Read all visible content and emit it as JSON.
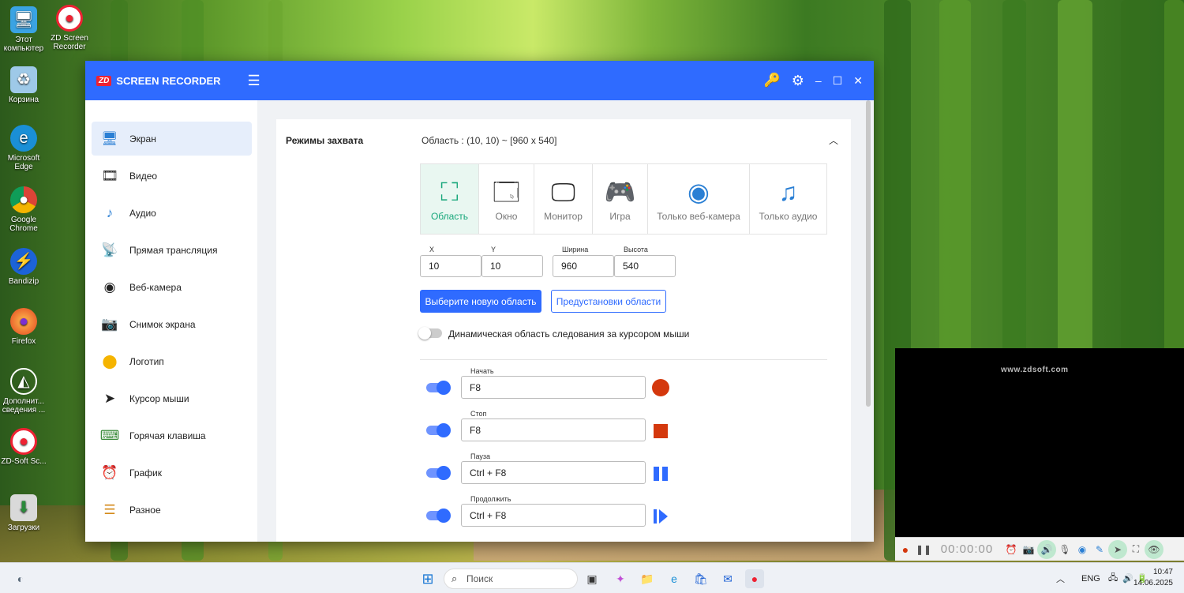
{
  "desktop": {
    "icons": [
      {
        "label": "Этот компьютер"
      },
      {
        "label": "ZD Screen Recorder"
      },
      {
        "label": "Корзина"
      },
      {
        "label": "Microsoft Edge"
      },
      {
        "label": "Google Chrome"
      },
      {
        "label": "Bandizip"
      },
      {
        "label": "Firefox"
      },
      {
        "label": "Дополнит... сведения ..."
      },
      {
        "label": "ZD-Soft Sc..."
      },
      {
        "label": "Загрузки"
      }
    ]
  },
  "app": {
    "brand": "ZD",
    "title": "SCREEN RECORDER",
    "sidebar": [
      {
        "label": "Экран",
        "icon": "monitor-icon"
      },
      {
        "label": "Видео",
        "icon": "film-icon"
      },
      {
        "label": "Аудио",
        "icon": "music-icon"
      },
      {
        "label": "Прямая трансляция",
        "icon": "broadcast-icon"
      },
      {
        "label": "Веб-камера",
        "icon": "webcam-icon"
      },
      {
        "label": "Снимок экрана",
        "icon": "camera-icon"
      },
      {
        "label": "Логотип",
        "icon": "logo-icon"
      },
      {
        "label": "Курсор мыши",
        "icon": "cursor-icon"
      },
      {
        "label": "Горячая клавиша",
        "icon": "keyboard-icon"
      },
      {
        "label": "График",
        "icon": "alarm-clock-icon"
      },
      {
        "label": "Разное",
        "icon": "sliders-icon"
      }
    ],
    "capture": {
      "title": "Режимы захвата",
      "area_info": "Область : (10, 10) ~ [960 x 540]",
      "modes": [
        {
          "label": "Область",
          "icon": "region-icon"
        },
        {
          "label": "Окно",
          "icon": "window-icon"
        },
        {
          "label": "Монитор",
          "icon": "monitor-icon"
        },
        {
          "label": "Игра",
          "icon": "game-icon"
        },
        {
          "label": "Только веб-камера",
          "icon": "webcam-icon"
        },
        {
          "label": "Только аудио",
          "icon": "music-note-icon"
        }
      ],
      "x_label": "X",
      "x_value": "10",
      "y_label": "Y",
      "y_value": "10",
      "width_label": "Ширина",
      "width_value": "960",
      "height_label": "Высота",
      "height_value": "540",
      "select_area_button": "Выберите новую область",
      "presets_button": "Предустановки области",
      "dynamic_label": "Динамическая область следования за курсором мыши"
    },
    "hotkeys": [
      {
        "label": "Начать",
        "value": "F8"
      },
      {
        "label": "Стоп",
        "value": "F8"
      },
      {
        "label": "Пауза",
        "value": "Ctrl + F8"
      },
      {
        "label": "Продолжить",
        "value": "Ctrl + F8"
      }
    ]
  },
  "preview": {
    "watermark": "www.zdsoft.com",
    "timer": "00:00:00"
  },
  "taskbar": {
    "search_placeholder": "Поиск",
    "language": "ENG",
    "time": "10:47",
    "date": "14.06.2025"
  },
  "colors": {
    "accent": "#2f6bff",
    "active_green": "#18a77b",
    "record_red": "#d4380d"
  }
}
